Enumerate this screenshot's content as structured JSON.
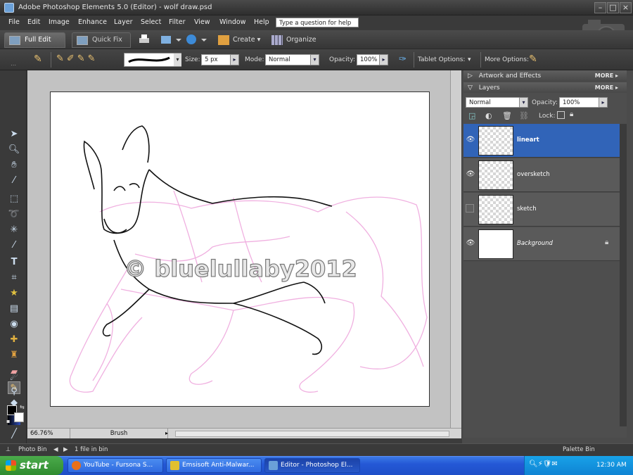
{
  "window": {
    "title": "Adobe Photoshop Elements 5.0 (Editor) - wolf draw.psd"
  },
  "menu": [
    "File",
    "Edit",
    "Image",
    "Enhance",
    "Layer",
    "Select",
    "Filter",
    "View",
    "Window",
    "Help"
  ],
  "help_placeholder": "Type a question for help",
  "modes": {
    "full_edit": "Full Edit",
    "quick_fix": "Quick Fix",
    "create": "Create",
    "organize": "Organize"
  },
  "options": {
    "size_label": "Size:",
    "size_value": "5 px",
    "mode_label": "Mode:",
    "mode_value": "Normal",
    "opacity_label": "Opacity:",
    "opacity_value": "100%",
    "tablet_label": "Tablet Options:",
    "more_label": "More Options:"
  },
  "canvas": {
    "watermark": "© bluelullaby2012"
  },
  "status": {
    "zoom": "66.76%",
    "tool": "Brush"
  },
  "bottombar": {
    "photo_bin": "Photo Bin",
    "files": "1 file in bin",
    "palette_bin": "Palette Bin"
  },
  "palette": {
    "artwork": "Artwork and Effects",
    "layers": "Layers",
    "more": "MORE",
    "blend_mode": "Normal",
    "opacity_label": "Opacity:",
    "opacity_value": "100%",
    "lock_label": "Lock:",
    "layers_list": [
      {
        "name": "lineart",
        "visible": true,
        "selected": true
      },
      {
        "name": "oversketch",
        "visible": true,
        "selected": false
      },
      {
        "name": "sketch",
        "visible": false,
        "selected": false
      },
      {
        "name": "Background",
        "visible": true,
        "selected": false,
        "locked": true
      }
    ]
  },
  "taskbar": {
    "start": "start",
    "tasks": [
      "YouTube - Fursona S...",
      "Emsisoft Anti-Malwar...",
      "Editor - Photoshop El..."
    ],
    "clock": "12:30 AM"
  }
}
